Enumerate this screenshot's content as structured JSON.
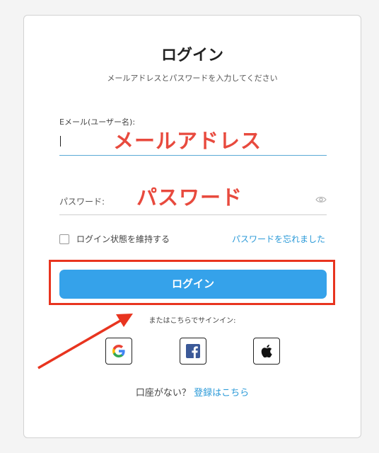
{
  "login_form": {
    "title": "ログイン",
    "subtitle": "メールアドレスとパスワードを入力してください",
    "email_label": "Eメール(ユーザー名):",
    "email_value": "",
    "password_label": "パスワード:",
    "password_value": "",
    "remember_label": "ログイン状態を維持する",
    "remember_checked": false,
    "forgot_link": "パスワードを忘れました",
    "submit_label": "ログイン",
    "social_prompt": "またはこちらでサインイン:",
    "social": [
      "google-icon",
      "facebook-icon",
      "apple-icon"
    ],
    "signup_prompt": "口座がない？",
    "signup_link": "登録はこちら"
  },
  "annotations": {
    "email_callout": "メールアドレス",
    "password_callout": "パスワード",
    "highlight_color": "#e8341f",
    "callout_color": "#e84a3e"
  },
  "colors": {
    "accent": "#35a2ea",
    "link": "#2b9ad8"
  }
}
